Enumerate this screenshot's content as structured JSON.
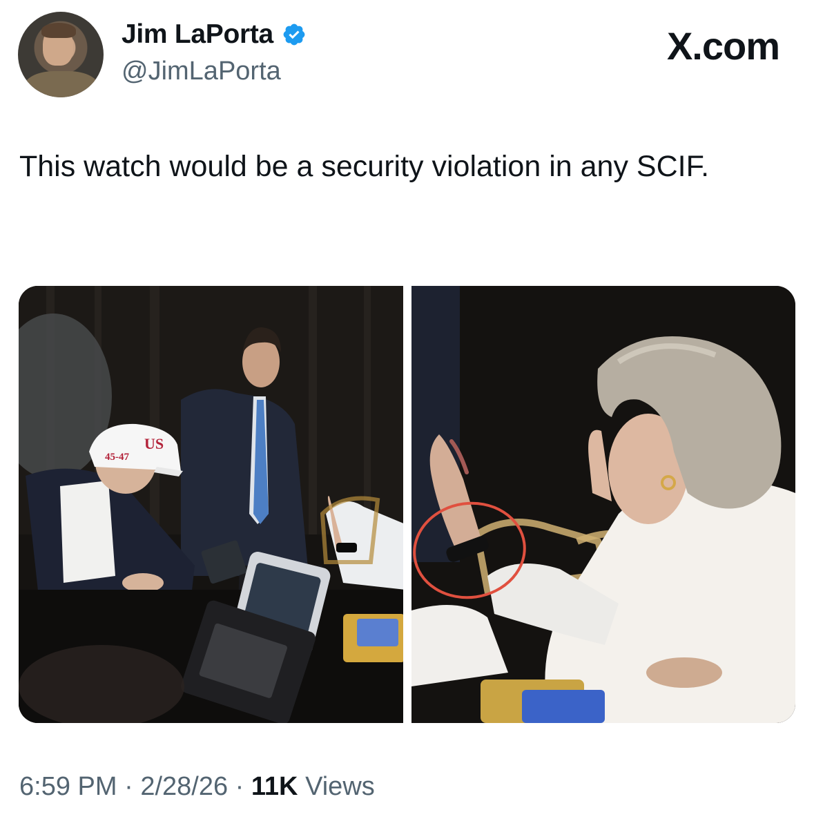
{
  "author": {
    "name": "Jim LaPorta",
    "handle": "@JimLaPorta",
    "verified": true,
    "verified_color": "#1d9bf0"
  },
  "brand": "X.com",
  "tweet": {
    "text": "This watch would be a security violation in any SCIF."
  },
  "media": {
    "left_photo": {
      "hat_text": "45-47",
      "hat_text_2": "US"
    },
    "right_photo": {
      "annotation_color": "#e0503f"
    }
  },
  "meta": {
    "time": "6:59 PM",
    "separator": "·",
    "date": "2/28/26",
    "views_count": "11K",
    "views_label": "Views"
  }
}
